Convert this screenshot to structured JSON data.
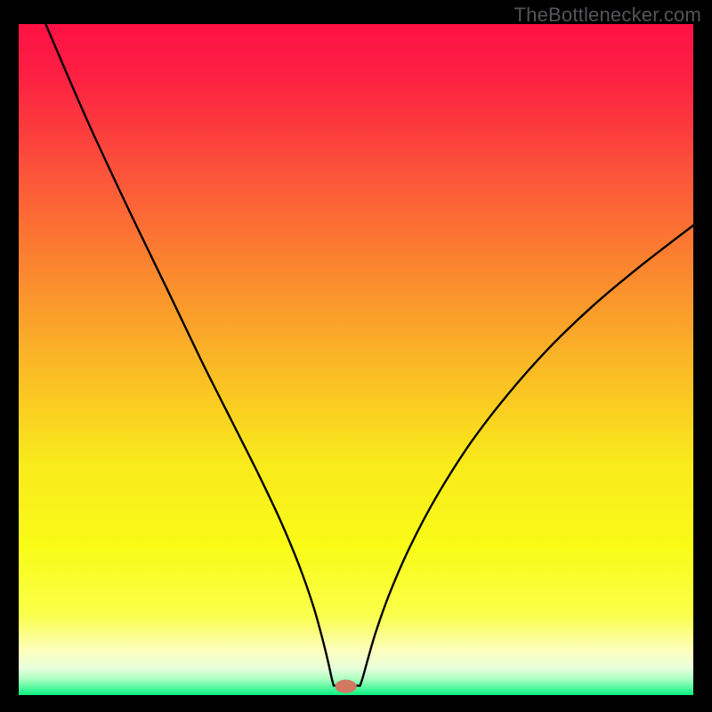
{
  "watermark": "TheBottlenecker.com",
  "chart_data": {
    "type": "line",
    "title": "",
    "xlabel": "",
    "ylabel": "",
    "xlim": [
      0,
      100
    ],
    "ylim": [
      0,
      100
    ],
    "background": {
      "type": "vertical-gradient",
      "stops": [
        {
          "offset": 0.0,
          "color": "#fd1144"
        },
        {
          "offset": 0.08,
          "color": "#fd2042"
        },
        {
          "offset": 0.2,
          "color": "#fc4b3b"
        },
        {
          "offset": 0.35,
          "color": "#fb8130"
        },
        {
          "offset": 0.5,
          "color": "#fab626"
        },
        {
          "offset": 0.65,
          "color": "#f9e91c"
        },
        {
          "offset": 0.78,
          "color": "#f9fb17"
        },
        {
          "offset": 0.88,
          "color": "#faff4a"
        },
        {
          "offset": 0.935,
          "color": "#fdffc0"
        },
        {
          "offset": 0.96,
          "color": "#e7ffdb"
        },
        {
          "offset": 0.975,
          "color": "#b0ffc4"
        },
        {
          "offset": 0.988,
          "color": "#5cf9a1"
        },
        {
          "offset": 1.0,
          "color": "#09f07f"
        }
      ]
    },
    "marker": {
      "x": 48.5,
      "y": 1.3,
      "rx": 1.6,
      "ry": 1.0,
      "color": "#d07862"
    },
    "curve_left": {
      "description": "left descending branch from top-left toward minimum",
      "points": [
        [
          4.0,
          100.0
        ],
        [
          10.0,
          86.0
        ],
        [
          16.0,
          73.0
        ],
        [
          22.0,
          60.5
        ],
        [
          27.0,
          50.0
        ],
        [
          31.5,
          41.0
        ],
        [
          35.5,
          33.0
        ],
        [
          38.8,
          26.0
        ],
        [
          41.5,
          19.5
        ],
        [
          43.6,
          13.5
        ],
        [
          45.0,
          8.5
        ],
        [
          45.9,
          4.8
        ],
        [
          46.4,
          2.5
        ],
        [
          46.7,
          1.4
        ]
      ]
    },
    "curve_flat": {
      "description": "flat segment along the bottom near the minimum",
      "points": [
        [
          46.7,
          1.4
        ],
        [
          50.6,
          1.4
        ]
      ]
    },
    "curve_right": {
      "description": "right ascending branch from minimum toward upper right",
      "points": [
        [
          50.6,
          1.4
        ],
        [
          51.0,
          2.6
        ],
        [
          51.8,
          5.5
        ],
        [
          53.0,
          9.6
        ],
        [
          55.0,
          15.2
        ],
        [
          58.0,
          22.1
        ],
        [
          62.0,
          29.7
        ],
        [
          67.0,
          37.6
        ],
        [
          72.5,
          44.8
        ],
        [
          78.5,
          51.6
        ],
        [
          85.0,
          57.9
        ],
        [
          92.0,
          63.8
        ],
        [
          100.0,
          70.0
        ]
      ]
    }
  }
}
